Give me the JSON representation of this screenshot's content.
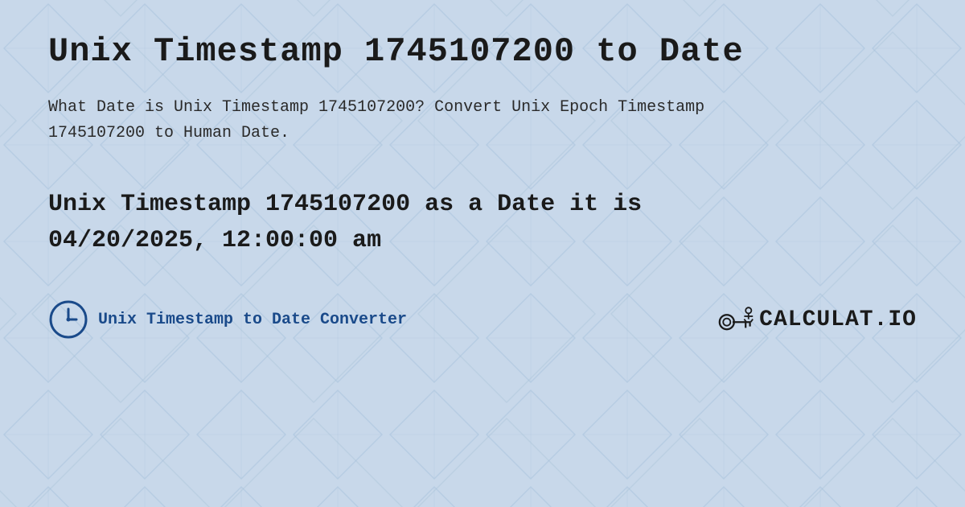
{
  "page": {
    "title": "Unix Timestamp 1745107200 to Date",
    "description": "What Date is Unix Timestamp 1745107200? Convert Unix Epoch Timestamp 1745107200 to Human Date.",
    "result_line1": "Unix Timestamp 1745107200 as a Date it is",
    "result_line2": "04/20/2025, 12:00:00 am",
    "footer_link": "Unix Timestamp to Date Converter",
    "logo_text": "CALCULAT.IO",
    "background_color": "#c8d8e8",
    "accent_color": "#1a4a8a"
  }
}
